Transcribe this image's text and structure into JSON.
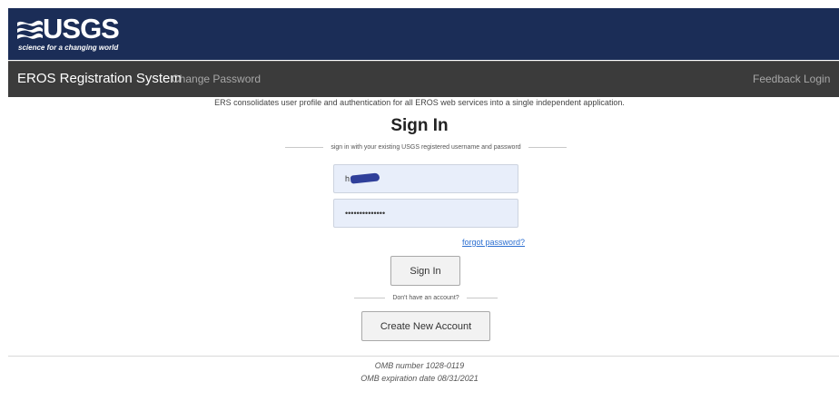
{
  "header": {
    "logo_wordmark": "USGS",
    "logo_tagline": "science for a changing world",
    "banner_color": "#1b2d57"
  },
  "navbar": {
    "brand": "EROS Registration System",
    "links": {
      "change_password": "Change Password",
      "feedback": "Feedback",
      "login": "Login"
    },
    "background_color": "#3b3b3b"
  },
  "intro_text": "ERS consolidates user profile and authentication for all EROS web services into a single independent application.",
  "sign_in": {
    "title": "Sign In",
    "subtitle": "sign in with your existing USGS registered username and password",
    "username_value": "h",
    "password_value": "••••••••••••••",
    "forgot_password_label": "forgot password?",
    "submit_label": "Sign In",
    "field_background": "#e8eefa"
  },
  "register": {
    "prompt": "Don't have an account?",
    "button_label": "Create New Account"
  },
  "footer": {
    "omb_number": "OMB number 1028-0119",
    "omb_expiration": "OMB expiration date 08/31/2021"
  }
}
